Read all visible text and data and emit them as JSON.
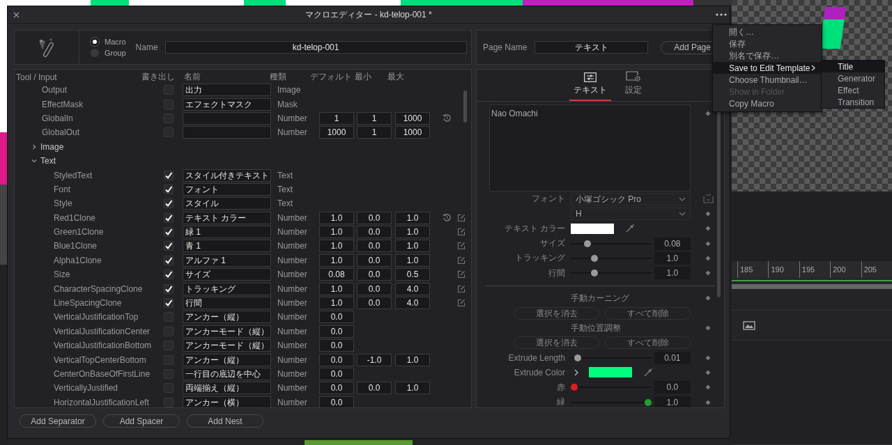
{
  "window": {
    "title": "マクロエディター - kd-telop-001 *"
  },
  "macro": {
    "types": [
      {
        "label": "Macro",
        "selected": true
      },
      {
        "label": "Group",
        "selected": false
      }
    ],
    "name_label": "Name",
    "name": "kd-telop-001"
  },
  "table": {
    "columns": [
      "Tool / Input",
      "書き出し",
      "名前",
      "種類",
      "デフォルト",
      "最小",
      "最大"
    ],
    "rows": [
      {
        "kind": "input",
        "tool": "Output",
        "export": false,
        "name": "出力",
        "type": "Image"
      },
      {
        "kind": "input",
        "tool": "EffectMask",
        "export": false,
        "name": "エフェクトマスク",
        "type": "Mask"
      },
      {
        "kind": "input",
        "tool": "GlobalIn",
        "export": false,
        "type": "Number",
        "default": "1",
        "min": "1",
        "max": "1000",
        "actions": [
          {
            "kind": "reset"
          }
        ]
      },
      {
        "kind": "input",
        "tool": "GlobalOut",
        "export": false,
        "type": "Number",
        "default": "1000",
        "min": "1",
        "max": "1000"
      },
      {
        "kind": "group",
        "tool": "Image",
        "expanded": false
      },
      {
        "kind": "group",
        "tool": "Text",
        "expanded": true,
        "children": [
          {
            "kind": "input",
            "tool": "StyledText",
            "export": true,
            "name": "スタイル付きテキスト",
            "type": "Text"
          },
          {
            "kind": "input",
            "tool": "Font",
            "export": true,
            "name": "フォント",
            "type": "Text"
          },
          {
            "kind": "input",
            "tool": "Style",
            "export": true,
            "name": "スタイル",
            "type": "Text"
          },
          {
            "kind": "input",
            "tool": "Red1Clone",
            "export": true,
            "name": "テキスト カラー",
            "type": "Number",
            "default": "1.0",
            "min": "0.0",
            "max": "1.0",
            "actions": [
              {
                "kind": "reset"
              },
              {
                "kind": "edit"
              }
            ]
          },
          {
            "kind": "input",
            "tool": "Green1Clone",
            "export": true,
            "name": "緑 1",
            "type": "Number",
            "default": "1.0",
            "min": "0.0",
            "max": "1.0",
            "actions": [
              {
                "kind": "edit"
              }
            ]
          },
          {
            "kind": "input",
            "tool": "Blue1Clone",
            "export": true,
            "name": "青 1",
            "type": "Number",
            "default": "1.0",
            "min": "0.0",
            "max": "1.0",
            "actions": [
              {
                "kind": "edit"
              }
            ]
          },
          {
            "kind": "input",
            "tool": "Alpha1Clone",
            "export": true,
            "name": "アルファ 1",
            "type": "Number",
            "default": "1.0",
            "min": "0.0",
            "max": "1.0",
            "actions": [
              {
                "kind": "edit"
              }
            ]
          },
          {
            "kind": "input",
            "tool": "Size",
            "export": true,
            "name": "サイズ",
            "type": "Number",
            "default": "0.08",
            "min": "0.0",
            "max": "0.5",
            "actions": [
              {
                "kind": "edit"
              }
            ]
          },
          {
            "kind": "input",
            "tool": "CharacterSpacingClone",
            "export": true,
            "name": "トラッキング",
            "type": "Number",
            "default": "1.0",
            "min": "0.0",
            "max": "4.0",
            "actions": [
              {
                "kind": "edit"
              }
            ]
          },
          {
            "kind": "input",
            "tool": "LineSpacingClone",
            "export": true,
            "name": "行間",
            "type": "Number",
            "default": "1.0",
            "min": "0.0",
            "max": "4.0",
            "actions": [
              {
                "kind": "edit"
              }
            ]
          },
          {
            "kind": "input",
            "tool": "VerticalJustificationTop",
            "export": false,
            "name": "アンカー（縦）",
            "type": "Number",
            "default": "0.0"
          },
          {
            "kind": "input",
            "tool": "VerticalJustificationCenter",
            "export": false,
            "name": "アンカーモード（縦）",
            "type": "Number",
            "default": "0.0"
          },
          {
            "kind": "input",
            "tool": "VerticalJustificationBottom",
            "export": false,
            "name": "アンカーモード（縦）",
            "type": "Number",
            "default": "0.0"
          },
          {
            "kind": "input",
            "tool": "VerticalTopCenterBottom",
            "export": false,
            "name": "アンカー（縦）",
            "type": "Number",
            "default": "0.0",
            "min": "-1.0",
            "max": "1.0"
          },
          {
            "kind": "input",
            "tool": "CenterOnBaseOfFirstLine",
            "export": false,
            "name": "一行目の底辺を中心",
            "type": "Number",
            "default": "0.0"
          },
          {
            "kind": "input",
            "tool": "VerticallyJustified",
            "export": false,
            "name": "両端揃え（縦）",
            "type": "Number",
            "default": "0.0",
            "min": "0.0",
            "max": "1.0"
          },
          {
            "kind": "input",
            "tool": "HorizontalJustificationLeft",
            "export": false,
            "name": "アンカー（横）",
            "type": "Number",
            "default": "0.0"
          }
        ]
      }
    ]
  },
  "footer_buttons": [
    "Add Separator",
    "Add Spacer",
    "Add Nest"
  ],
  "page": {
    "label": "Page Name",
    "value": "テキスト",
    "add_button": "Add Page"
  },
  "tabs": [
    {
      "kind": "sliders",
      "label": "テキスト",
      "selected": true
    },
    {
      "kind": "settings",
      "label": "設定",
      "selected": false
    }
  ],
  "inspector": {
    "text": "Nao Omachi",
    "controls": [
      {
        "kind": "dropdown",
        "label": "フォント",
        "value": "小塚ゴシック Pro"
      },
      {
        "kind": "dropdown",
        "value": "H"
      },
      {
        "kind": "color",
        "label": "テキスト カラー",
        "color": "#ffffff"
      },
      {
        "kind": "slider",
        "label": "サイズ",
        "level": 0.18,
        "value": "0.08"
      },
      {
        "kind": "slider",
        "label": "トラッキング",
        "level": 0.27,
        "value": "1.0"
      },
      {
        "kind": "slider",
        "label": "行間",
        "level": 0.27,
        "value": "1.0"
      },
      {
        "kind": "divider"
      },
      {
        "kind": "heading",
        "label": "手動カーニング"
      },
      {
        "kind": "buttons",
        "buttons": [
          {
            "label": "選択を消去",
            "disabled": true
          },
          {
            "label": "すべて削除",
            "disabled": true
          }
        ]
      },
      {
        "kind": "heading",
        "label": "手動位置調整"
      },
      {
        "kind": "buttons",
        "buttons": [
          {
            "label": "選択を消去",
            "disabled": true
          },
          {
            "label": "すべて削除",
            "disabled": true
          }
        ]
      },
      {
        "kind": "slider",
        "label": "Extrude Length",
        "level": 0.05,
        "value": "0.01"
      },
      {
        "kind": "color",
        "label": "Extrude Color",
        "color": "#00ff80",
        "expanded": false
      },
      {
        "kind": "slider",
        "label": "赤",
        "level": 0,
        "value": "0.0",
        "color": "#e02020"
      },
      {
        "kind": "slider",
        "label": "緑",
        "level": 1,
        "value": "1.0",
        "color": "#20a030"
      }
    ]
  },
  "menu": {
    "items": [
      {
        "label": "開く…",
        "selected": false,
        "disabled": false,
        "submenu": false
      },
      {
        "label": "保存",
        "selected": false,
        "disabled": false,
        "submenu": false
      },
      {
        "label": "別名で保存…",
        "selected": false,
        "disabled": false,
        "submenu": false
      },
      {
        "label": "Save to Edit Template",
        "selected": true,
        "disabled": false,
        "submenu": true
      },
      {
        "label": "Choose Thumbnail…",
        "selected": false,
        "disabled": false,
        "submenu": false
      },
      {
        "label": "Show in Folder",
        "selected": false,
        "disabled": true,
        "submenu": false
      },
      {
        "label": "Copy Macro",
        "selected": false,
        "disabled": false,
        "submenu": false
      }
    ],
    "submenu": [
      {
        "label": "Title",
        "selected": true
      },
      {
        "label": "Generator",
        "selected": false
      },
      {
        "label": "Effect",
        "selected": false
      },
      {
        "label": "Transition",
        "selected": false
      }
    ]
  },
  "timeline": {
    "ruler": [
      "185",
      "190",
      "195",
      "200",
      "205"
    ]
  }
}
